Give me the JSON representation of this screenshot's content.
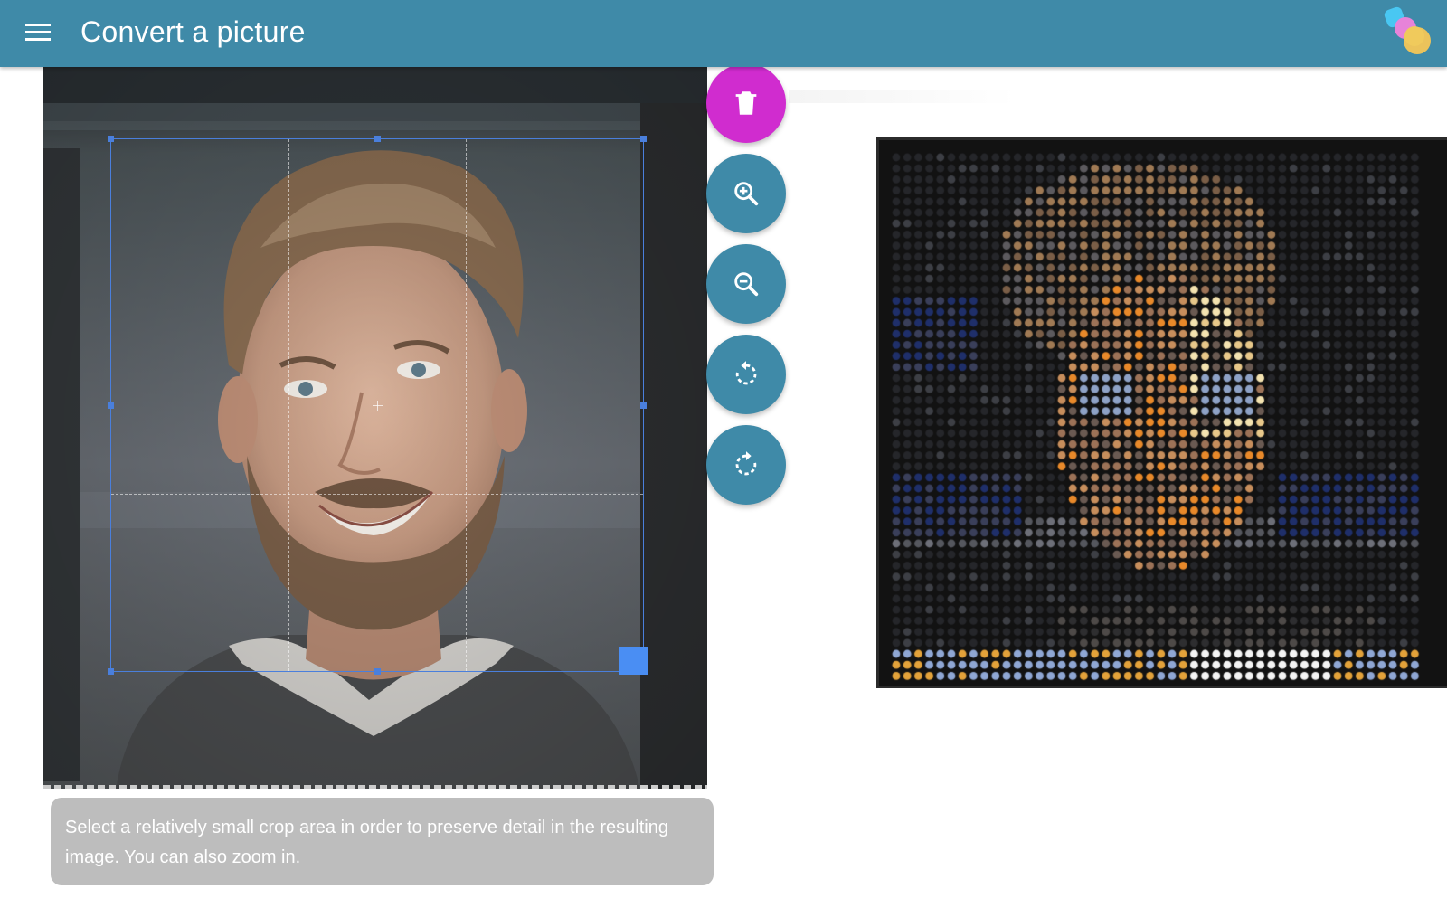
{
  "app_bar": {
    "title": "Convert a picture",
    "menu_icon": "hamburger-menu-icon",
    "logo_icon": "app-logo-icon",
    "background": "#3f8aa8"
  },
  "editor": {
    "actions": [
      {
        "name": "delete-button",
        "icon": "trash-icon",
        "color": "#d02ccf"
      },
      {
        "name": "zoom-in-button",
        "icon": "zoom-in-icon",
        "color": "#3f8aa8"
      },
      {
        "name": "zoom-out-button",
        "icon": "zoom-out-icon",
        "color": "#3f8aa8"
      },
      {
        "name": "rotate-left-button",
        "icon": "rotate-left-icon",
        "color": "#3f8aa8"
      },
      {
        "name": "rotate-right-button",
        "icon": "rotate-right-icon",
        "color": "#3f8aa8"
      }
    ],
    "crop_handle_color": "#4a8ef3",
    "hint": "Select a relatively small crop area in order to preserve detail in the resulting image. You can also zoom in."
  },
  "result": {
    "grid_columns": 48,
    "grid_rows": 48
  }
}
